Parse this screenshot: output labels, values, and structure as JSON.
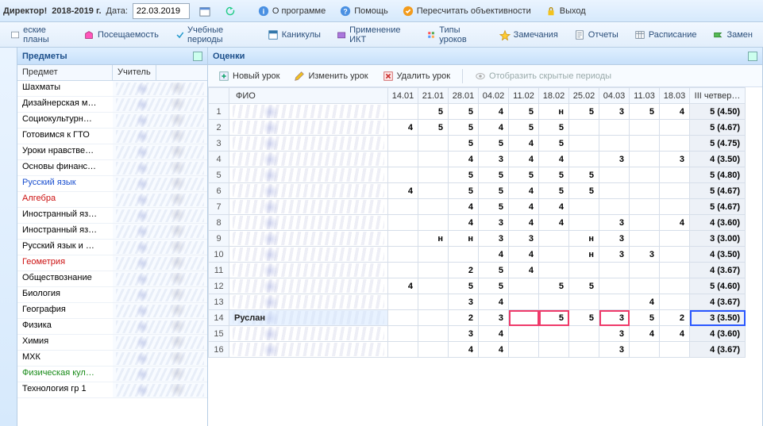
{
  "top": {
    "director": "Директор!",
    "year": "2018-2019 г.",
    "date_label": "Дата:",
    "date_value": "22.03.2019",
    "about": "О программе",
    "help": "Помощь",
    "recalc": "Пересчитать объективности",
    "exit": "Выход"
  },
  "tabs": [
    "еские планы",
    "Посещаемость",
    "Учебные периоды",
    "Каникулы",
    "Применение ИКТ",
    "Типы уроков",
    "Замечания",
    "Отчеты",
    "Расписание",
    "Замен"
  ],
  "subjects": {
    "title": "Предметы",
    "col_subject": "Предмет",
    "col_teacher": "Учитель",
    "items": [
      {
        "name": "Шахматы",
        "cls": ""
      },
      {
        "name": "Дизайнерская м…",
        "cls": ""
      },
      {
        "name": "Социокультурн…",
        "cls": ""
      },
      {
        "name": "Готовимся к ГТО",
        "cls": ""
      },
      {
        "name": "Уроки нравстве…",
        "cls": ""
      },
      {
        "name": "Основы финанс…",
        "cls": ""
      },
      {
        "name": "Русский язык",
        "cls": "blue"
      },
      {
        "name": "Алгебра",
        "cls": "red"
      },
      {
        "name": "Иностранный яз…",
        "cls": ""
      },
      {
        "name": "Иностранный яз…",
        "cls": ""
      },
      {
        "name": "Русский язык и …",
        "cls": ""
      },
      {
        "name": "Геометрия",
        "cls": "red"
      },
      {
        "name": "Обществознание",
        "cls": ""
      },
      {
        "name": "Биология",
        "cls": ""
      },
      {
        "name": "География",
        "cls": ""
      },
      {
        "name": "Физика",
        "cls": ""
      },
      {
        "name": "Химия",
        "cls": ""
      },
      {
        "name": "МХК",
        "cls": ""
      },
      {
        "name": "Физическая кул…",
        "cls": "green"
      },
      {
        "name": "Технология гр 1",
        "cls": ""
      }
    ]
  },
  "grades": {
    "title": "Оценки",
    "toolbar": {
      "new": "Новый урок",
      "edit": "Изменить урок",
      "del": "Удалить урок",
      "show_hidden": "Отобразить скрытые периоды"
    },
    "headers": {
      "fio": "ФИО",
      "quarter": "III четвер…",
      "dates": [
        "14.01",
        "21.01",
        "28.01",
        "04.02",
        "11.02",
        "18.02",
        "25.02",
        "04.03",
        "11.03",
        "18.03"
      ]
    },
    "rows": [
      {
        "n": 1,
        "name": "",
        "cells": [
          "",
          "",
          "5",
          "5",
          "4",
          "5",
          "н",
          "5",
          "3",
          "5",
          "4"
        ],
        "q": "5 (4.50)"
      },
      {
        "n": 2,
        "name": "",
        "cells": [
          "",
          "4",
          "5",
          "5",
          "4",
          "5",
          "5",
          "",
          "",
          "",
          ""
        ],
        "q": "5 (4.67)"
      },
      {
        "n": 3,
        "name": "",
        "cells": [
          "",
          "",
          "",
          "5",
          "5",
          "4",
          "5",
          "",
          "",
          "",
          ""
        ],
        "q": "5 (4.75)"
      },
      {
        "n": 4,
        "name": "",
        "cells": [
          "",
          "",
          "",
          "4",
          "3",
          "4",
          "4",
          "",
          "3",
          "",
          "3",
          "4"
        ],
        "q": "4 (3.50)"
      },
      {
        "n": 5,
        "name": "",
        "cells": [
          "",
          "",
          "",
          "5",
          "5",
          "5",
          "5",
          "5",
          "",
          "",
          "",
          ""
        ],
        "q": "5 (4.80)"
      },
      {
        "n": 6,
        "name": "",
        "cells": [
          "",
          "4",
          "",
          "5",
          "5",
          "4",
          "5",
          "5",
          "",
          "",
          "",
          ""
        ],
        "q": "5 (4.67)"
      },
      {
        "n": 7,
        "name": "",
        "cells": [
          "",
          "",
          "",
          "4",
          "5",
          "4",
          "4",
          "",
          "",
          "",
          "",
          ""
        ],
        "q": "5 (4.67)"
      },
      {
        "n": 8,
        "name": "",
        "cells": [
          "",
          "",
          "",
          "4",
          "3",
          "4",
          "4",
          "",
          "3",
          "",
          "4",
          ""
        ],
        "q": "4 (3.60)"
      },
      {
        "n": 9,
        "name": "",
        "cells": [
          "",
          "",
          "н",
          "н",
          "3",
          "3",
          "",
          "н",
          "3",
          "",
          "",
          ""
        ],
        "q": "3 (3.00)"
      },
      {
        "n": 10,
        "name": "",
        "cells": [
          "",
          "",
          "",
          "",
          "4",
          "4",
          "",
          "н",
          "3",
          "3",
          "",
          "4"
        ],
        "q": "4 (3.50)"
      },
      {
        "n": 11,
        "name": "",
        "cells": [
          "",
          "",
          "",
          "2",
          "5",
          "4",
          "",
          "",
          "",
          "",
          "",
          ""
        ],
        "q": "4 (3.67)"
      },
      {
        "n": 12,
        "name": "",
        "cells": [
          "",
          "4",
          "",
          "5",
          "5",
          "",
          "5",
          "5",
          "",
          "",
          "",
          ""
        ],
        "q": "5 (4.60)"
      },
      {
        "n": 13,
        "name": "",
        "cells": [
          "",
          "",
          "",
          "3",
          "4",
          "",
          "",
          "",
          "",
          "4",
          "",
          ""
        ],
        "q": "4 (3.67)"
      },
      {
        "n": 14,
        "name": "Руслан",
        "cells": [
          "",
          "",
          "",
          "2",
          "3",
          "",
          "5",
          "5",
          "3",
          "5",
          "2",
          "3"
        ],
        "q": "3 (3.50)",
        "hl": {
          "5": "pink",
          "6": "pink",
          "8": "pink",
          "q": "blue"
        },
        "selected": true
      },
      {
        "n": 15,
        "name": "",
        "cells": [
          "",
          "",
          "",
          "3",
          "4",
          "",
          "",
          "",
          "3",
          "4",
          "4",
          ""
        ],
        "q": "4 (3.60)"
      },
      {
        "n": 16,
        "name": "",
        "cells": [
          "",
          "",
          "",
          "4",
          "4",
          "",
          "",
          "",
          "3",
          "",
          "",
          ""
        ],
        "q": "4 (3.67)"
      }
    ]
  },
  "icons": {
    "calendar": "calendar-icon",
    "refresh": "refresh-icon",
    "info": "info-icon",
    "help": "help-icon",
    "recalc": "recalc-icon",
    "exit": "lock-icon",
    "flag": "flag-icon",
    "play": "play-icon",
    "chart": "chart-icon",
    "display": "display-icon",
    "types": "types-icon",
    "note": "note-icon",
    "report": "report-icon",
    "sched": "schedule-icon",
    "swap": "swap-icon",
    "new": "plus-icon",
    "edit": "pencil-icon",
    "del": "trash-icon",
    "show": "eye-icon",
    "pin": "pin-icon"
  }
}
